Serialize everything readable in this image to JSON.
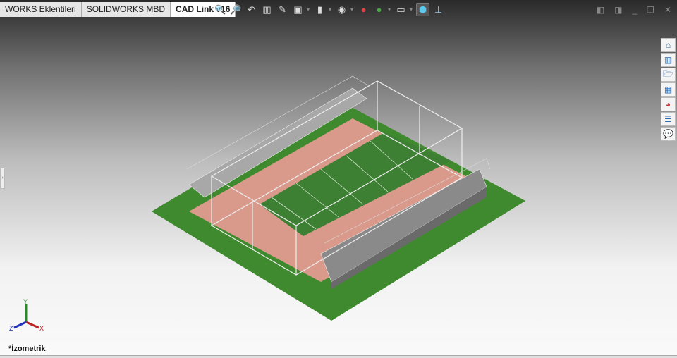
{
  "tabs": [
    {
      "label": "WORKS Eklentileri"
    },
    {
      "label": "SOLIDWORKS MBD"
    },
    {
      "label": "CAD Link v16",
      "active": true
    }
  ],
  "toolbar": [
    "zoom-to-fit-icon",
    "zoom-to-area-icon",
    "previous-view-icon",
    "section-view-icon",
    "dynamic-annotation-icon",
    "view-orientation-icon",
    "display-style-icon",
    "hide-show-icon",
    "edit-appearance-icon",
    "apply-scene-icon",
    "view-settings-icon",
    "isometric-view-icon",
    "normal-to-icon"
  ],
  "task_pane": [
    "home-icon",
    "parts-library-icon",
    "file-explorer-icon",
    "view-palette-icon",
    "appearances-icon",
    "custom-properties-icon",
    "forum-icon"
  ],
  "triad": {
    "x": "X",
    "y": "Y",
    "z": "Z"
  },
  "view_name": "*İzometrik",
  "colors": {
    "grass": "#3f8a2e",
    "track": "#d99a8c",
    "field": "#3d7f33",
    "frame": "#e8e8e8"
  }
}
